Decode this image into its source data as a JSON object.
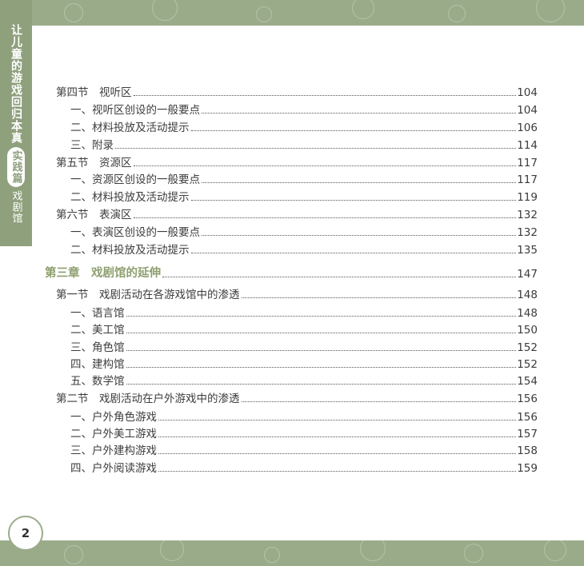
{
  "header": {
    "side_title": "让儿童的游戏回归本真",
    "side_badge": "实践篇",
    "side_subtitle": "戏剧馆"
  },
  "page_number": "2",
  "toc": [
    {
      "level": "section",
      "text": "第四节　视听区",
      "page": "104"
    },
    {
      "level": "item",
      "text": "一、视听区创设的一般要点",
      "page": "104"
    },
    {
      "level": "item",
      "text": "二、材料投放及活动提示",
      "page": "106"
    },
    {
      "level": "item",
      "text": "三、附录",
      "page": "114"
    },
    {
      "level": "section",
      "text": "第五节　资源区",
      "page": "117"
    },
    {
      "level": "item",
      "text": "一、资源区创设的一般要点",
      "page": "117"
    },
    {
      "level": "item",
      "text": "二、材料投放及活动提示",
      "page": "119"
    },
    {
      "level": "section",
      "text": "第六节　表演区",
      "page": "132"
    },
    {
      "level": "item",
      "text": "一、表演区创设的一般要点",
      "page": "132"
    },
    {
      "level": "item",
      "text": "二、材料投放及活动提示",
      "page": "135"
    },
    {
      "level": "chapter",
      "text": "第三章　戏剧馆的延伸",
      "page": "147"
    },
    {
      "level": "section",
      "text": "第一节　戏剧活动在各游戏馆中的渗透",
      "page": "148"
    },
    {
      "level": "item",
      "text": "一、语言馆",
      "page": "148"
    },
    {
      "level": "item",
      "text": "二、美工馆",
      "page": "150"
    },
    {
      "level": "item",
      "text": "三、角色馆",
      "page": "152"
    },
    {
      "level": "item",
      "text": "四、建构馆",
      "page": "152"
    },
    {
      "level": "item",
      "text": "五、数学馆",
      "page": "154"
    },
    {
      "level": "section",
      "text": "第二节　戏剧活动在户外游戏中的渗透",
      "page": "156"
    },
    {
      "level": "item",
      "text": "一、户外角色游戏",
      "page": "156"
    },
    {
      "level": "item",
      "text": "二、户外美工游戏",
      "page": "157"
    },
    {
      "level": "item",
      "text": "三、户外建构游戏",
      "page": "158"
    },
    {
      "level": "item",
      "text": "四、户外阅读游戏",
      "page": "159"
    }
  ]
}
